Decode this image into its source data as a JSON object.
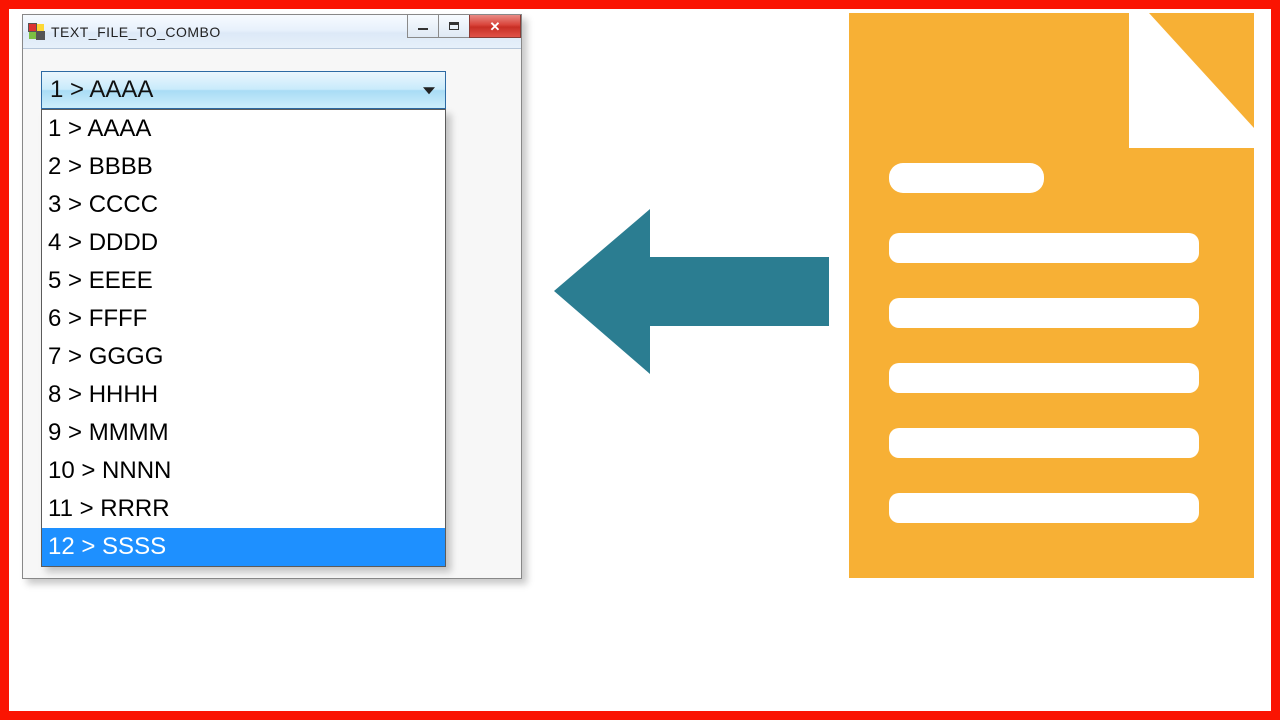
{
  "window": {
    "title": "TEXT_FILE_TO_COMBO"
  },
  "combo": {
    "selected": "1 > AAAA",
    "items": [
      "1 > AAAA",
      "2 > BBBB",
      "3 > CCCC",
      "4 > DDDD",
      "5 > EEEE",
      "6 > FFFF",
      "7 > GGGG",
      "8 > HHHH",
      "9 > MMMM",
      "10 > NNNN",
      "11 > RRRR",
      "12 > SSSS"
    ],
    "highlighted_index": 11
  },
  "colors": {
    "frame": "#fa1402",
    "arrow": "#2b7d91",
    "file": "#f7b035"
  }
}
